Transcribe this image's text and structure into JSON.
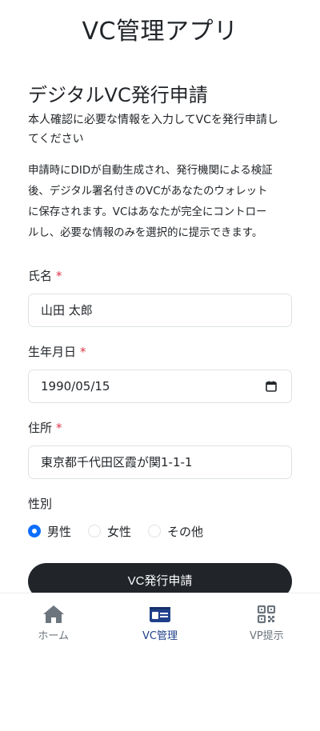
{
  "app": {
    "title": "VC管理アプリ"
  },
  "form": {
    "title": "デジタルVC発行申請",
    "subtitle_line1": "本人確認に必要な情報を入力してVCを発行申請し",
    "subtitle_line2": "てください",
    "desc_lines": [
      "申請時にDIDが自動生成され、発行機関による検証",
      "後、デジタル署名付きのVCがあなたのウォレット",
      "に保存されます。VCはあなたが完全にコントロー",
      "ルし、必要な情報のみを選択的に提示できます。"
    ],
    "name": {
      "label": "氏名",
      "required_mark": "*",
      "value": "山田 太郎"
    },
    "birthdate": {
      "label": "生年月日",
      "required_mark": "*",
      "value": "1990/05/15"
    },
    "address": {
      "label": "住所",
      "required_mark": "*",
      "value": "東京都千代田区霞が関1-1-1"
    },
    "gender": {
      "label": "性別",
      "options": [
        "男性",
        "女性",
        "その他"
      ],
      "selected": "男性"
    },
    "submit_label": "VC発行申請"
  },
  "nav": {
    "items": [
      {
        "label": "ホーム",
        "icon": "home-icon",
        "active": false
      },
      {
        "label": "VC管理",
        "icon": "id-card-icon",
        "active": true
      },
      {
        "label": "VP提示",
        "icon": "qr-code-icon",
        "active": false
      }
    ]
  },
  "colors": {
    "accent": "#0d6efd",
    "active_nav": "#1f3f8a",
    "required": "#dc3545",
    "button": "#212529"
  }
}
